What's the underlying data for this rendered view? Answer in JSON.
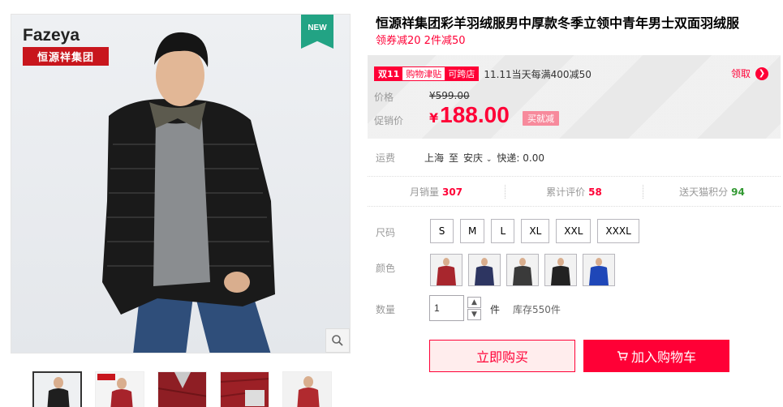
{
  "gallery": {
    "brand_en": "Fazeya",
    "brand_cn": "恒源祥集团",
    "new_badge": "NEW",
    "thumbnails": [
      {
        "name": "black-jacket",
        "color": "#1f1f1f"
      },
      {
        "name": "red-jacket-front",
        "color": "#a7232b"
      },
      {
        "name": "red-jacket-collar",
        "color": "#8e1e24"
      },
      {
        "name": "red-jacket-detail",
        "color": "#9c2026"
      },
      {
        "name": "red-jacket-model",
        "color": "#b12a2f"
      }
    ]
  },
  "product": {
    "title": "恒源祥集团彩羊羽绒服男中厚款冬季立领中青年男士双面羽绒服",
    "subtitle": "领券减20 2件减50"
  },
  "promo": {
    "badge_part1": "双11",
    "badge_part2": "购物津贴",
    "badge_part3": "可跨店",
    "text": "11.11当天每满400减50",
    "claim": "领取"
  },
  "price": {
    "label_orig": "价格",
    "orig": "¥599.00",
    "label_sale": "促销价",
    "currency": "¥",
    "sale": "188.00",
    "tag": "买就减"
  },
  "shipping": {
    "label": "运费",
    "from": "上海",
    "to_word": "至",
    "dest": "安庆",
    "method": "快递: 0.00"
  },
  "stats": {
    "monthly_label": "月销量",
    "monthly_value": "307",
    "reviews_label": "累计评价",
    "reviews_value": "58",
    "points_label": "送天猫积分",
    "points_value": "94"
  },
  "options": {
    "size_label": "尺码",
    "sizes": [
      "S",
      "M",
      "L",
      "XL",
      "XXL",
      "XXXL"
    ],
    "color_label": "颜色",
    "colors": [
      {
        "name": "red",
        "hex": "#a8262d"
      },
      {
        "name": "navy",
        "hex": "#2d3561"
      },
      {
        "name": "black-gray",
        "hex": "#3a3a3a"
      },
      {
        "name": "black",
        "hex": "#222222"
      },
      {
        "name": "royal-blue",
        "hex": "#1f47b8"
      }
    ]
  },
  "quantity": {
    "label": "数量",
    "value": "1",
    "unit": "件",
    "stock": "库存550件"
  },
  "actions": {
    "buy_now": "立即购买",
    "add_cart": "加入购物车"
  },
  "colors": {
    "accent": "#ff0036",
    "green": "#339933"
  }
}
